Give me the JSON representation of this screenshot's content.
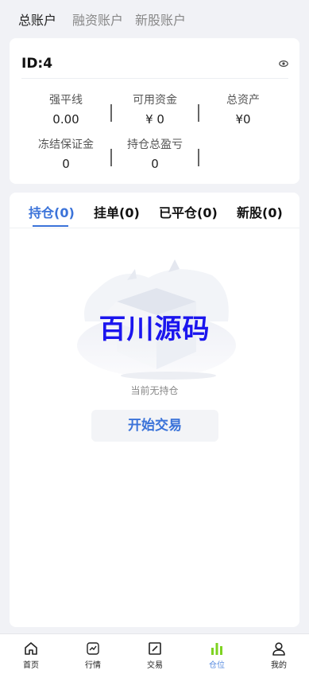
{
  "top_tabs": [
    {
      "label": "总账户",
      "active": true
    },
    {
      "label": "融资账户",
      "active": false
    },
    {
      "label": "新股账户",
      "active": false
    }
  ],
  "account": {
    "id_label": "ID:4",
    "stats": [
      {
        "label": "强平线",
        "value": "0.00"
      },
      {
        "label": "可用资金",
        "value": "¥ 0"
      },
      {
        "label": "总资产",
        "value": "¥0"
      },
      {
        "label": "冻结保证金",
        "value": "0"
      },
      {
        "label": "持仓总盈亏",
        "value": "0"
      }
    ]
  },
  "position_tabs": [
    {
      "label": "持仓(0)",
      "active": true
    },
    {
      "label": "挂单(0)",
      "active": false
    },
    {
      "label": "已平仓(0)",
      "active": false
    },
    {
      "label": "新股(0)",
      "active": false
    }
  ],
  "empty_state": {
    "watermark": "百川源码",
    "text": "当前无持仓",
    "button_label": "开始交易"
  },
  "bottom_nav": [
    {
      "label": "首页",
      "icon": "home-icon",
      "active": false
    },
    {
      "label": "行情",
      "icon": "chart-line-icon",
      "active": false
    },
    {
      "label": "交易",
      "icon": "trade-icon",
      "active": false
    },
    {
      "label": "仓位",
      "icon": "bar-chart-icon",
      "active": true
    },
    {
      "label": "我的",
      "icon": "user-icon",
      "active": false
    }
  ],
  "colors": {
    "accent": "#3b73d9",
    "active_icon": "#7ed321",
    "watermark": "#1b15ee",
    "background": "#f1f2f6"
  }
}
